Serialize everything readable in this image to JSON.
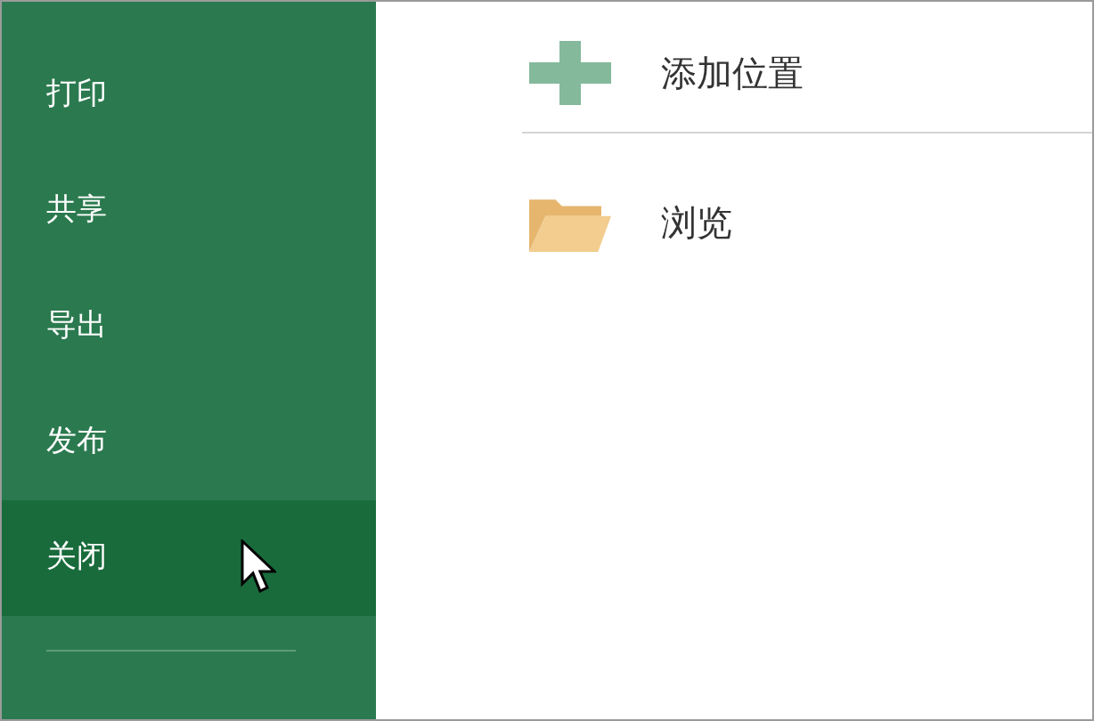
{
  "sidebar": {
    "items": [
      {
        "label": "打印",
        "selected": false
      },
      {
        "label": "共享",
        "selected": false
      },
      {
        "label": "导出",
        "selected": false
      },
      {
        "label": "发布",
        "selected": false
      },
      {
        "label": "关闭",
        "selected": true
      }
    ]
  },
  "locations": [
    {
      "kind": "add",
      "label": "添加位置"
    },
    {
      "kind": "browse",
      "label": "浏览"
    }
  ]
}
